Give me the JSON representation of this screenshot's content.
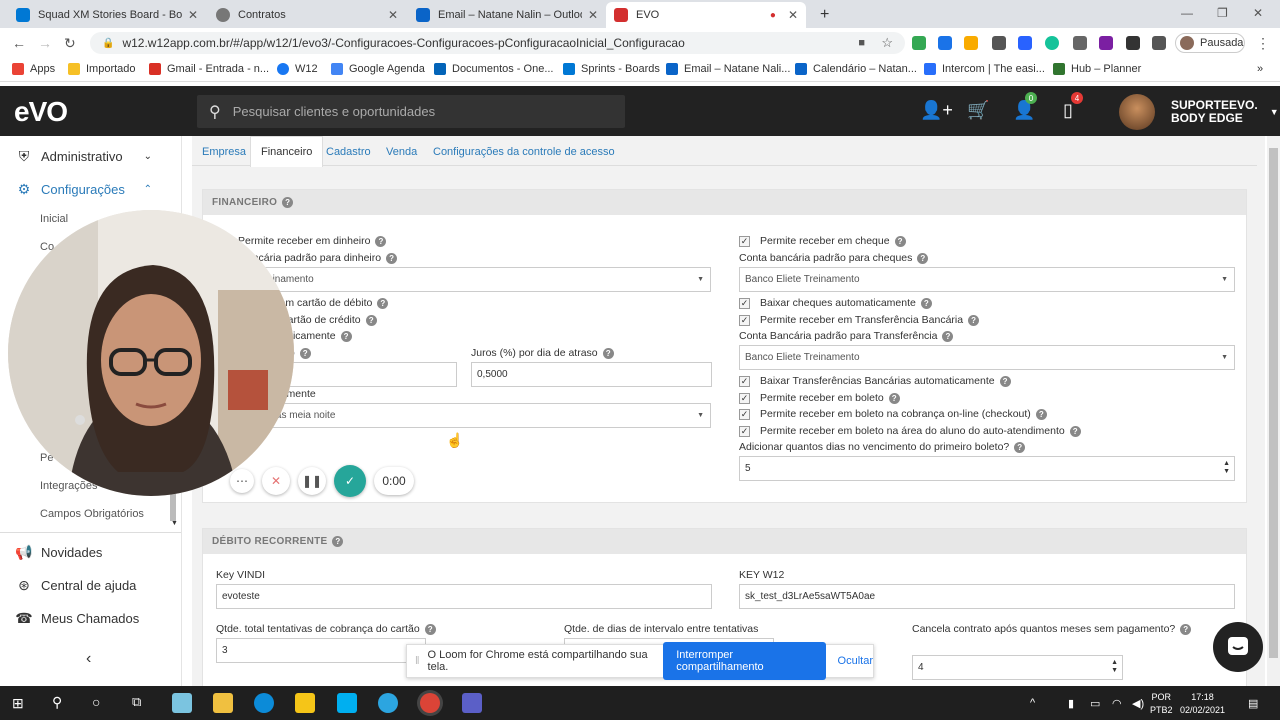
{
  "browser": {
    "tabs": [
      {
        "title": "Squad XM Stories Board - Boards",
        "icon_color": "#0078d4"
      },
      {
        "title": "Contratos",
        "icon_color": "#555"
      },
      {
        "title": "Email – Natane Nalin – Outlook",
        "icon_color": "#0a64c8"
      },
      {
        "title": "EVO",
        "icon_color": "#d32f2f"
      }
    ],
    "new_tab": "+",
    "url": "w12.w12app.com.br/#/app/w12/1/evo3/-Configuracoes-Configuracoes-pConfiguracaoInicial_Configuracao",
    "profile": "Pausada",
    "bookmarks": [
      "Apps",
      "Importado",
      "Gmail - Entrada - n...",
      "W12",
      "Google Agenda",
      "Documentos - One...",
      "Sprints - Boards",
      "Email – Natane Nali...",
      "Calendário – Natan...",
      "Intercom | The easi...",
      "Hub – Planner"
    ]
  },
  "app": {
    "logo": "eVO",
    "search_placeholder": "Pesquisar clientes e oportunidades",
    "badges": {
      "tasks": "0",
      "notifications": "4"
    },
    "user_line1": "SUPORTEEVO.",
    "user_line2": "BODY EDGE"
  },
  "sidebar": {
    "items": [
      {
        "label": "Administrativo",
        "icon": "shield-icon"
      },
      {
        "label": "Configurações",
        "icon": "gear-icon"
      }
    ],
    "subitems": [
      "Inicial",
      "Co",
      "Pe",
      "Integrações",
      "Campos Obrigatórios"
    ],
    "bottom": [
      "Novidades",
      "Central de ajuda",
      "Meus Chamados"
    ],
    "collapse": "‹"
  },
  "content_tabs": [
    "Empresa",
    "Financeiro",
    "Cadastro",
    "Venda",
    "Configurações da controle de acesso"
  ],
  "financeiro": {
    "title": "FINANCEIRO",
    "left": {
      "dinheiro": "Permite receber em dinheiro",
      "conta_dinheiro": "bancária padrão para dinheiro",
      "conta_dinheiro_value": "te Treinamento",
      "debito": "receber em cartão de débito",
      "credito": "eber em cartão de crédito",
      "baixar": "es automaticamente",
      "vencimento": "vencimento",
      "juros_label": "Juros (%) por dia de atraso",
      "juros_value": "0,5000",
      "auto_label": "utomaticamente",
      "auto_value": "s os dias meia noite"
    },
    "right": {
      "cheque": "Permite receber em cheque",
      "conta_cheque": "Conta bancária padrão para cheques",
      "conta_cheque_value": "Banco Eliete Treinamento",
      "baixar_cheques": "Baixar cheques automaticamente",
      "transferencia": "Permite receber em Transferência Bancária",
      "conta_transf": "Conta Bancária padrão para Transferência",
      "conta_transf_value": "Banco Eliete Treinamento",
      "baixar_transf": "Baixar Transferências Bancárias automaticamente",
      "boleto": "Permite receber em boleto",
      "boleto_online": "Permite receber em boleto na cobrança on-line (checkout)",
      "boleto_aluno": "Permite receber em boleto na área do aluno do auto-atendimento",
      "dias_label": "Adicionar quantos dias no vencimento do primeiro boleto?",
      "dias_value": "5"
    }
  },
  "debito": {
    "title": "DÉBITO RECORRENTE",
    "key_vindi_label": "Key VINDI",
    "key_vindi_value": "evoteste",
    "key_w12_label": "KEY W12",
    "key_w12_value": "sk_test_d3LrAe5saWT5A0ae",
    "tentativas_label": "Qtde. total tentativas de cobrança do cartão",
    "tentativas_value": "3",
    "intervalo_label": "Qtde. de dias de intervalo entre tentativas",
    "cancela_label": "Cancela contrato após quantos meses sem pagamento?",
    "cancela_value": "4"
  },
  "recorder": {
    "timer": "0:00"
  },
  "loom": {
    "message": "O Loom for Chrome está compartilhando sua tela.",
    "stop": "Interromper compartilhamento",
    "hide": "Ocultar"
  },
  "taskbar": {
    "lang1": "POR",
    "lang2": "PTB2",
    "time": "17:18",
    "date": "02/02/2021"
  }
}
